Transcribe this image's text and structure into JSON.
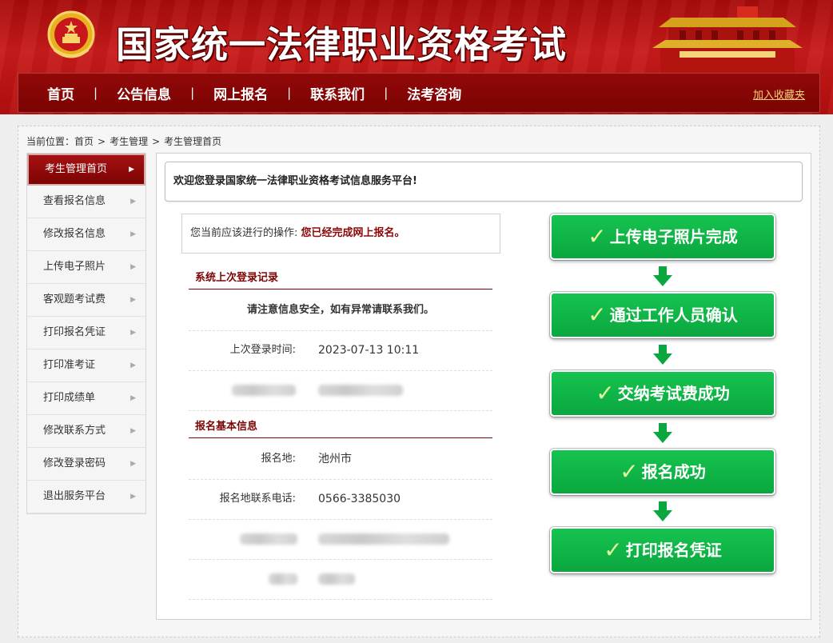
{
  "header": {
    "site_title": "国家统一法律职业资格考试",
    "nav": [
      "首页",
      "公告信息",
      "网上报名",
      "联系我们",
      "法考咨询"
    ],
    "nav_sep": "|",
    "favorite_link": "加入收藏夹"
  },
  "breadcrumb": {
    "prefix": "当前位置：",
    "items": [
      "首页",
      "考生管理",
      "考生管理首页"
    ],
    "sep": ">"
  },
  "sidebar": {
    "items": [
      {
        "label": "考生管理首页",
        "active": true
      },
      {
        "label": "查看报名信息"
      },
      {
        "label": "修改报名信息"
      },
      {
        "label": "上传电子照片"
      },
      {
        "label": "客观题考试费"
      },
      {
        "label": "打印报名凭证"
      },
      {
        "label": "打印准考证"
      },
      {
        "label": "打印成绩单"
      },
      {
        "label": "修改联系方式"
      },
      {
        "label": "修改登录密码"
      },
      {
        "label": "退出服务平台"
      }
    ],
    "arrow": "▶"
  },
  "main": {
    "welcome": "欢迎您登录国家统一法律职业资格考试信息服务平台!",
    "action_label": "您当前应该进行的操作:",
    "action_value": "您已经完成网上报名。",
    "login_section_title": "系统上次登录记录",
    "notice": "请注意信息安全，如有异常请联系我们。",
    "last_login_label": "上次登录时间:",
    "last_login_value": "2023-07-13 10:11",
    "reg_section_title": "报名基本信息",
    "reg_place_label": "报名地:",
    "reg_place_value": "池州市",
    "reg_phone_label": "报名地联系电话:",
    "reg_phone_value": "0566-3385030"
  },
  "steps": {
    "check": "✓",
    "items": [
      "上传电子照片完成",
      "通过工作人员确认",
      "交纳考试费成功",
      "报名成功",
      "打印报名凭证"
    ]
  },
  "colors": {
    "header_red": "#b30e0e",
    "nav_dark_red": "#7a0303",
    "step_green": "#0aa73f",
    "section_title_red": "#7a0606"
  }
}
